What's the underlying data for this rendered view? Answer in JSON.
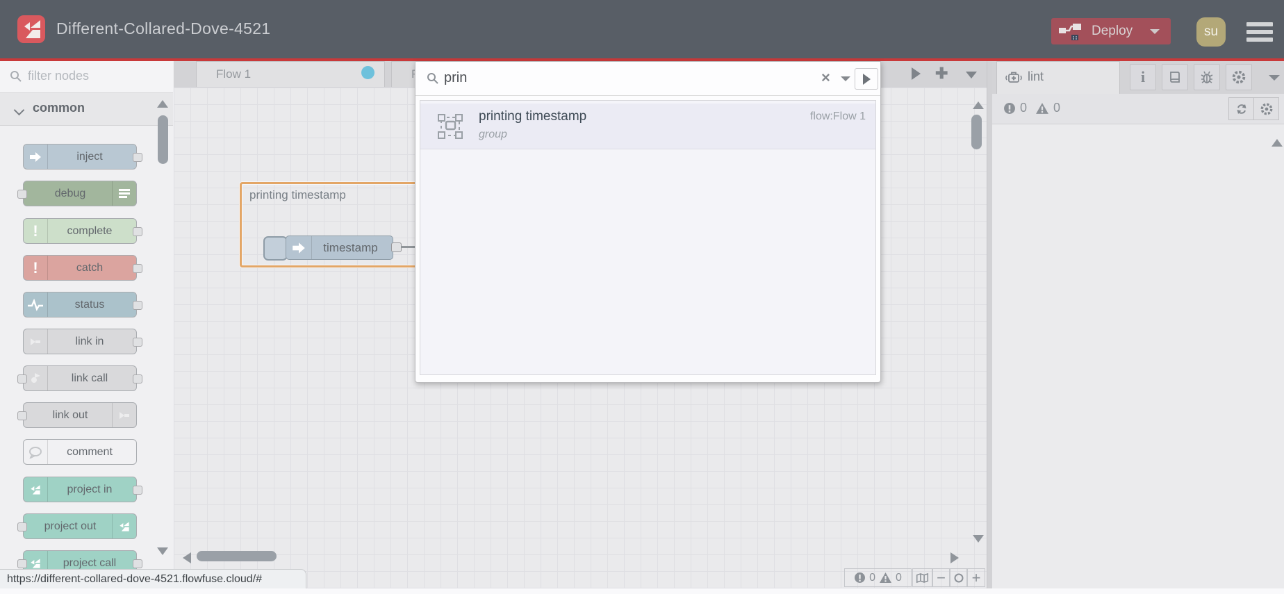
{
  "header": {
    "title": "Different-Collared-Dove-4521",
    "deploy_label": "Deploy",
    "avatar_text": "su",
    "colors": {
      "header_bg": "#585e66",
      "accent_red": "#c8393a",
      "deploy_bg": "#a3505a",
      "avatar_bg": "#b3a878"
    }
  },
  "palette": {
    "filter_placeholder": "filter nodes",
    "category_label": "common",
    "nodes": [
      {
        "label": "inject",
        "color": "#b9c8d3",
        "icon": "inject-arrow-icon"
      },
      {
        "label": "debug",
        "color": "#a2b69d",
        "icon": "debug-list-icon"
      },
      {
        "label": "complete",
        "color": "#cddfca",
        "icon": "exclamation-icon"
      },
      {
        "label": "catch",
        "color": "#dba49f",
        "icon": "exclamation-icon"
      },
      {
        "label": "status",
        "color": "#abc2cb",
        "icon": "pulse-icon"
      },
      {
        "label": "link in",
        "color": "#d9d9db",
        "icon": "link-arrow-icon"
      },
      {
        "label": "link call",
        "color": "#d9d9db",
        "icon": "link-call-icon"
      },
      {
        "label": "link out",
        "color": "#d9d9db",
        "icon": "link-arrow-icon"
      },
      {
        "label": "comment",
        "color": "#f1f1f3",
        "icon": "comment-bubble-icon"
      },
      {
        "label": "project in",
        "color": "#9fd2c5",
        "icon": "flowfuse-icon"
      },
      {
        "label": "project out",
        "color": "#9fd2c5",
        "icon": "flowfuse-icon"
      },
      {
        "label": "project call",
        "color": "#9fd2c5",
        "icon": "flowfuse-icon"
      }
    ]
  },
  "tabs": {
    "active_label": "Flow 1",
    "partial_label": "Fl",
    "modified_dot_color": "#6ec1dc"
  },
  "canvas": {
    "group_label": "printing timestamp",
    "inject_label": "timestamp",
    "group_border_color": "#e3a666"
  },
  "search_dialog": {
    "query": "prin",
    "result": {
      "title": "printing timestamp",
      "flow_ref": "flow:Flow 1",
      "type": "group"
    }
  },
  "sidebar": {
    "tab_label": "lint",
    "error_count": "0",
    "warning_count": "0"
  },
  "canvas_footer": {
    "error_count": "0",
    "warning_count": "0",
    "zoom_out_label": "−",
    "zoom_reset_label": "",
    "zoom_in_label": "+"
  },
  "statusbar": {
    "url": "https://different-collared-dove-4521.flowfuse.cloud/#"
  }
}
